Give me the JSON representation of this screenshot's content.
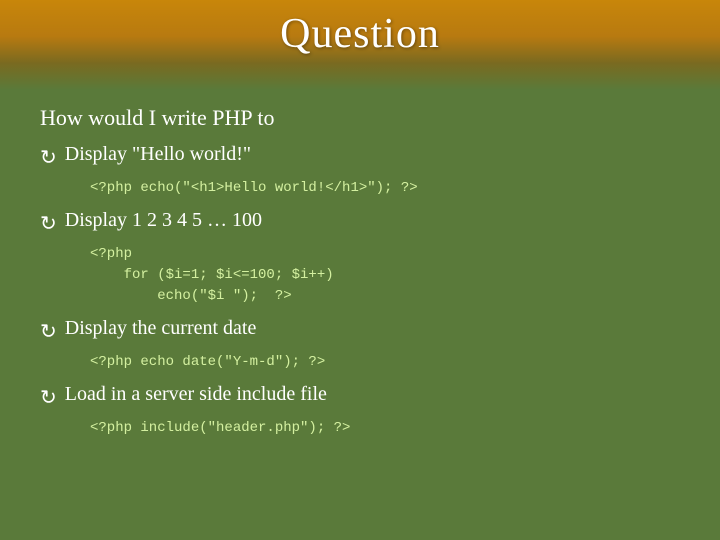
{
  "slide": {
    "title": "Question",
    "intro": "How would I write PHP to",
    "bullets": [
      {
        "label": "Display \"Hello world!\"",
        "code": "<?php echo(\"<h1>Hello world!</h1>\"); ?>"
      },
      {
        "label": "Display 1 2 3 4 5 … 100",
        "code": "<?php\n    for ($i=1; $i<=100; $i++)\n        echo(\"$i \");  ?>"
      },
      {
        "label": "Display the current date",
        "code": "<?php echo date(\"Y-m-d\"); ?>"
      },
      {
        "label": "Load in a server side include file",
        "code": "<?php include(\"header.php\"); ?>"
      }
    ]
  },
  "colors": {
    "background": "#5a7a3a",
    "top_band": "#c8860a",
    "text": "#ffffff",
    "code": "#d4f0a0"
  }
}
